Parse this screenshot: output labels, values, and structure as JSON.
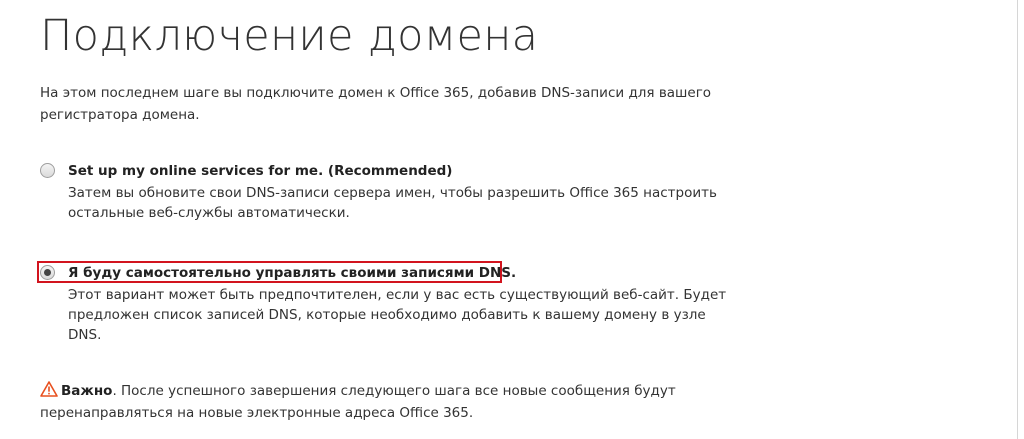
{
  "header": {
    "title": "Подключение домена"
  },
  "intro": {
    "text": "На этом последнем шаге вы подключите домен к Office 365, добавив DNS-записи для вашего регистратора домена."
  },
  "options": [
    {
      "label": "Set up my online services for me. (Recommended)",
      "description": "Затем вы обновите свои DNS-записи сервера имен, чтобы разрешить Office 365 настроить остальные веб-службы автоматически.",
      "selected": false
    },
    {
      "label": "Я буду самостоятельно управлять своими записями DNS.",
      "description": "Этот вариант может быть предпочтителен, если у вас есть существующий веб-сайт. Будет предложен список записей DNS, которые необходимо добавить к вашему домену в узле DNS.",
      "selected": true
    }
  ],
  "warning": {
    "icon": "warning-triangle-icon",
    "strong": "Важно",
    "text": ". После успешного завершения следующего шага все новые сообщения будут перенаправляться на новые электронные адреса Office 365."
  },
  "colors": {
    "highlight": "#d2141e",
    "warning_icon": "#e8501f"
  }
}
